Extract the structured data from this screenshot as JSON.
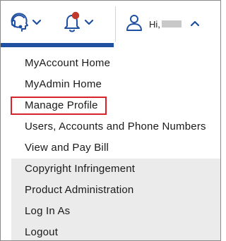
{
  "header": {
    "greeting": "Hi,",
    "username_masked": true
  },
  "icons": {
    "support": "headset-support-icon",
    "notifications": "bell-icon",
    "user": "user-icon"
  },
  "colors": {
    "accent": "#1f4fa1",
    "icon_blue": "#1f4fa1",
    "notification_dot": "#c0392b",
    "highlight_box": "#d8232a",
    "secondary_menu_bg": "#ebebeb"
  },
  "menu": {
    "primary_items": [
      {
        "label": "MyAccount Home"
      },
      {
        "label": "MyAdmin Home"
      },
      {
        "label": "Manage Profile"
      },
      {
        "label": "Users, Accounts and Phone Numbers"
      },
      {
        "label": "View and Pay Bill"
      }
    ],
    "secondary_items": [
      {
        "label": "Copyright Infringement"
      },
      {
        "label": "Product Administration"
      },
      {
        "label": "Log In As"
      },
      {
        "label": "Logout"
      }
    ]
  }
}
